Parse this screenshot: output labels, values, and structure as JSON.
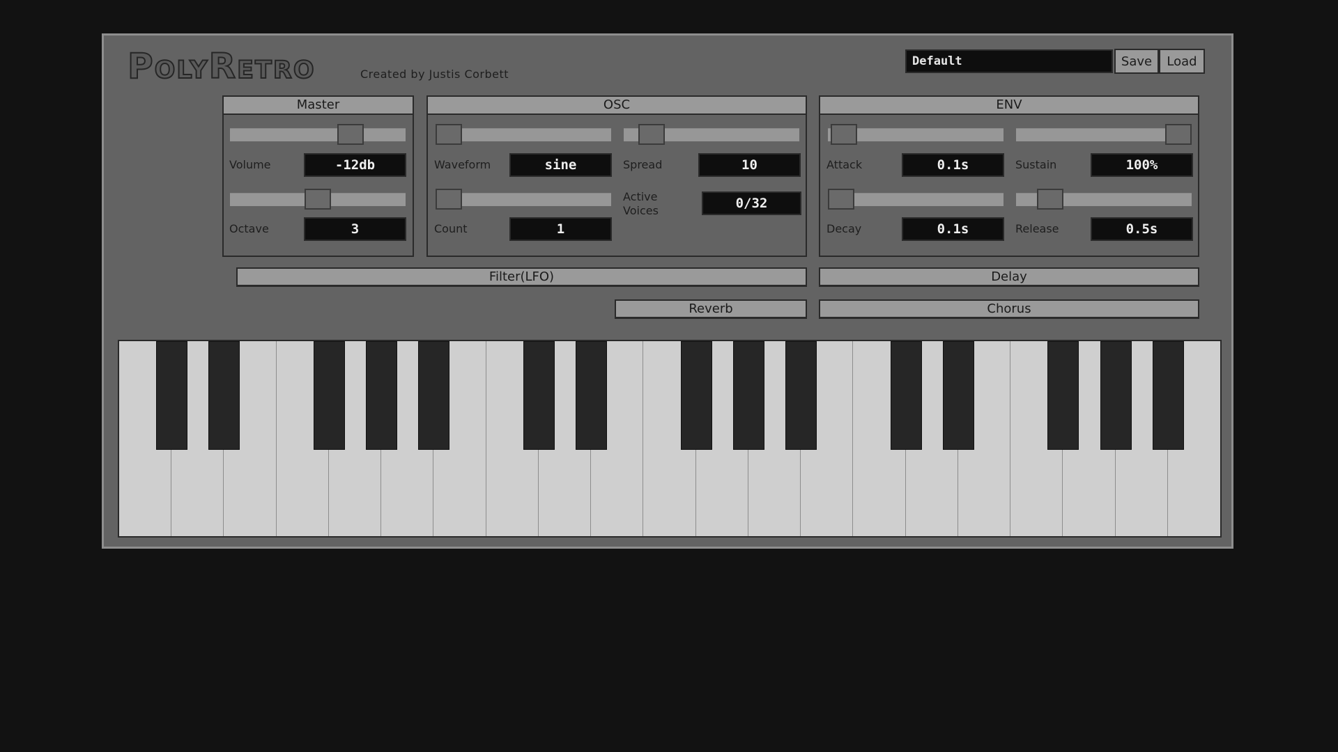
{
  "header": {
    "logo": "PolyRetro",
    "credit": "Created by Justis Corbett",
    "preset_value": "Default",
    "save_label": "Save",
    "load_label": "Load"
  },
  "master": {
    "title": "Master",
    "volume_label": "Volume",
    "volume_value": "-12db",
    "volume_slider": 0.72,
    "octave_label": "Octave",
    "octave_value": "3",
    "octave_slider": 0.5
  },
  "osc": {
    "title": "OSC",
    "waveform_label": "Waveform",
    "waveform_value": "sine",
    "waveform_slider": 0.0,
    "spread_label": "Spread",
    "spread_value": "10",
    "spread_slider": 0.1,
    "count_label": "Count",
    "count_value": "1",
    "count_slider": 0.0,
    "active_voices_label": "Active Voices",
    "active_voices_value": "0/32"
  },
  "env": {
    "title": "ENV",
    "attack_label": "Attack",
    "attack_value": "0.1s",
    "attack_slider": 0.02,
    "sustain_label": "Sustain",
    "sustain_value": "100%",
    "sustain_slider": 1.0,
    "decay_label": "Decay",
    "decay_value": "0.1s",
    "decay_slider": 0.0,
    "release_label": "Release",
    "release_value": "0.5s",
    "release_slider": 0.14
  },
  "effects": {
    "filter_label": "Filter(LFO)",
    "delay_label": "Delay",
    "reverb_label": "Reverb",
    "chorus_label": "Chorus"
  },
  "keyboard": {
    "white_keys": 21,
    "black_key_pattern": [
      1,
      1,
      0,
      1,
      1,
      1,
      0,
      1,
      1,
      0,
      1,
      1,
      1,
      0,
      1,
      1,
      0,
      1,
      1,
      1,
      0
    ]
  },
  "colors": {
    "background": "#121212",
    "panel": "#636363",
    "header_bar": "#9a9a9a",
    "display": "#0e0e0e",
    "white_key": "#cfcfcf",
    "black_key": "#262626"
  }
}
